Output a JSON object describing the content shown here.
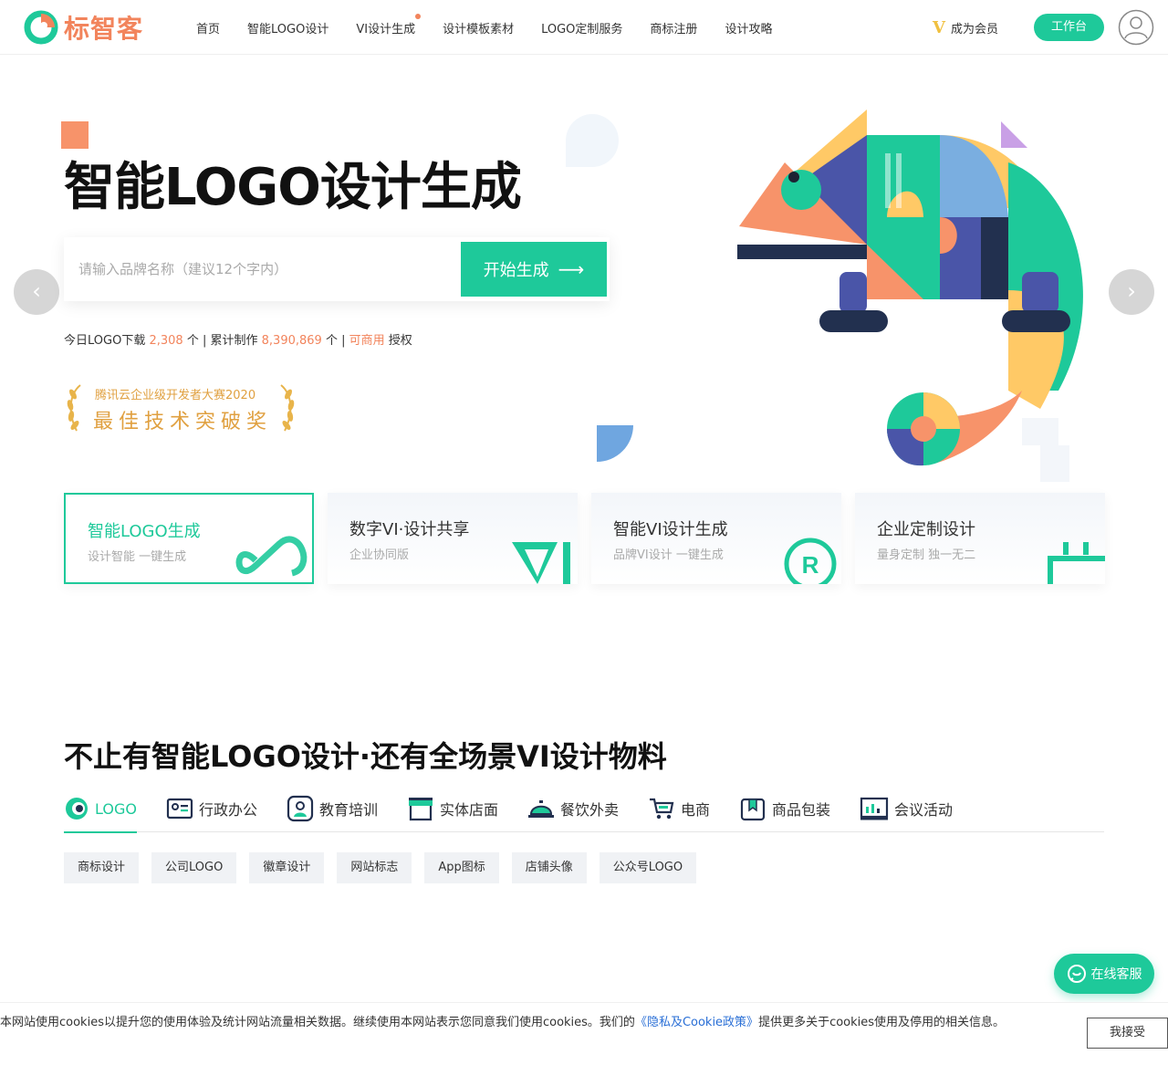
{
  "brand": {
    "name": "标智客"
  },
  "nav": {
    "items": [
      {
        "label": "首页"
      },
      {
        "label": "智能LOGO设计"
      },
      {
        "label": "VI设计生成",
        "dot": true
      },
      {
        "label": "设计模板素材"
      },
      {
        "label": "LOGO定制服务"
      },
      {
        "label": "商标注册"
      },
      {
        "label": "设计攻略"
      }
    ],
    "member_label": "成为会员",
    "workbench_label": "工作台"
  },
  "hero": {
    "title": "智能LOGO设计生成",
    "search_placeholder": "请输入品牌名称（建议12个字内）",
    "search_value": "",
    "search_button": "开始生成",
    "stats": {
      "download_label": "今日LOGO下载",
      "download_count": "2,308",
      "unit1": "个 |",
      "total_label": "累计制作",
      "total_count": "8,390,869",
      "unit2": "个 |",
      "commercial": "可商用",
      "license": "授权"
    },
    "award": {
      "line1": "腾讯云企业级开发者大赛2020",
      "line2": "最佳技术突破奖"
    }
  },
  "cards": [
    {
      "title": "智能LOGO生成",
      "sub": "设计智能 一键生成",
      "active": true
    },
    {
      "title": "数字VI·设计共享",
      "sub": "企业协同版"
    },
    {
      "title": "智能VI设计生成",
      "sub": "品牌VI设计 一键生成"
    },
    {
      "title": "企业定制设计",
      "sub": "量身定制 独一无二"
    }
  ],
  "section": {
    "title": "不止有智能LOGO设计·还有全场景VI设计物料",
    "tabs": [
      {
        "label": "LOGO",
        "icon": "logo-tab-icon",
        "active": true
      },
      {
        "label": "行政办公",
        "icon": "id-card-icon"
      },
      {
        "label": "教育培训",
        "icon": "student-icon"
      },
      {
        "label": "实体店面",
        "icon": "storefront-icon"
      },
      {
        "label": "餐饮外卖",
        "icon": "food-cloche-icon"
      },
      {
        "label": "电商",
        "icon": "cart-icon"
      },
      {
        "label": "商品包装",
        "icon": "package-icon"
      },
      {
        "label": "会议活动",
        "icon": "presentation-icon"
      }
    ],
    "chips": [
      "商标设计",
      "公司LOGO",
      "徽章设计",
      "网站标志",
      "App图标",
      "店铺头像",
      "公众号LOGO"
    ]
  },
  "service": {
    "label": "在线客服"
  },
  "cookie": {
    "text_before": "本网站使用cookies以提升您的使用体验及统计网站流量相关数据。继续使用本网站表示您同意我们使用cookies。我们的",
    "link": "《隐私及Cookie政策》",
    "text_after": "提供更多关于cookies使用及停用的相关信息。",
    "accept": "我接受"
  },
  "colors": {
    "accent": "#1ec99a",
    "orange": "#f2845c",
    "gold": "#e0a040"
  }
}
